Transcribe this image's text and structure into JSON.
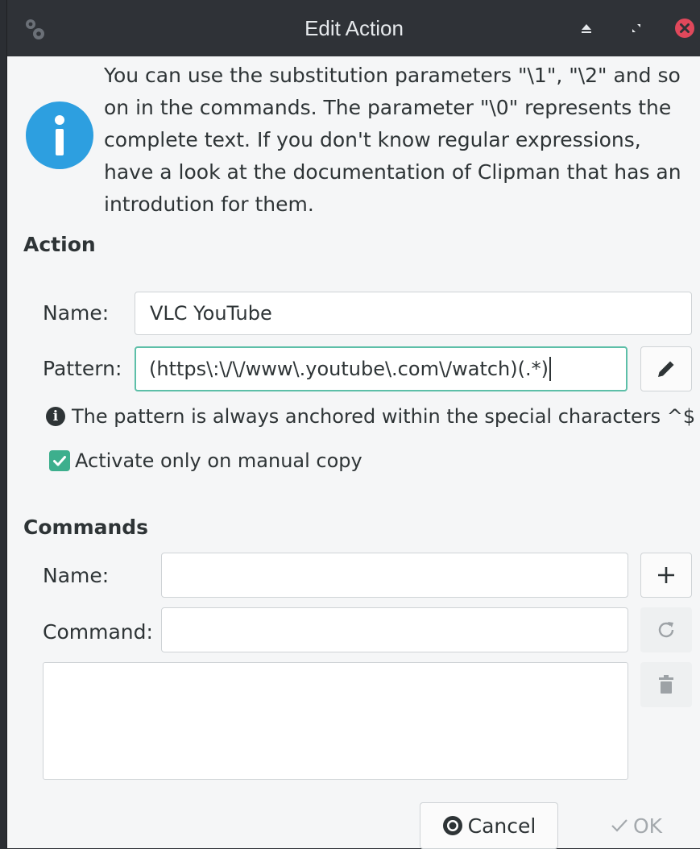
{
  "window": {
    "title": "Edit Action"
  },
  "info": {
    "text": "You can use the substitution parameters \"\\1\", \"\\2\" and so on in the commands. The parameter \"\\0\" represents the complete text. If you don't know regular expressions, have a look at the documentation of Clipman that has an introdution for them."
  },
  "action": {
    "section_title": "Action",
    "name_label": "Name:",
    "name_value": "VLC YouTube",
    "pattern_label": "Pattern:",
    "pattern_value": "(https\\:\\/\\/www\\.youtube\\.com\\/watch)(.*)",
    "hint_text": "The pattern is always anchored within the special characters ^$",
    "checkbox_label": "Activate only on manual copy",
    "checkbox_checked": true
  },
  "commands": {
    "section_title": "Commands",
    "name_label": "Name:",
    "name_value": "",
    "command_label": "Command:",
    "command_value": ""
  },
  "buttons": {
    "cancel_label": "Cancel",
    "ok_label": "OK"
  },
  "icons": {
    "app": "settings-gears-icon",
    "shade": "shade-icon",
    "maximize": "maximize-icon",
    "close": "close-icon",
    "info": "info-icon",
    "edit": "pencil-icon",
    "add": "plus-icon",
    "refresh": "refresh-icon",
    "delete": "trash-icon"
  },
  "colors": {
    "accent": "#3daf8d",
    "info_blue": "#2d9fe0",
    "close_red": "#e0485b",
    "titlebar": "#2f3237"
  }
}
